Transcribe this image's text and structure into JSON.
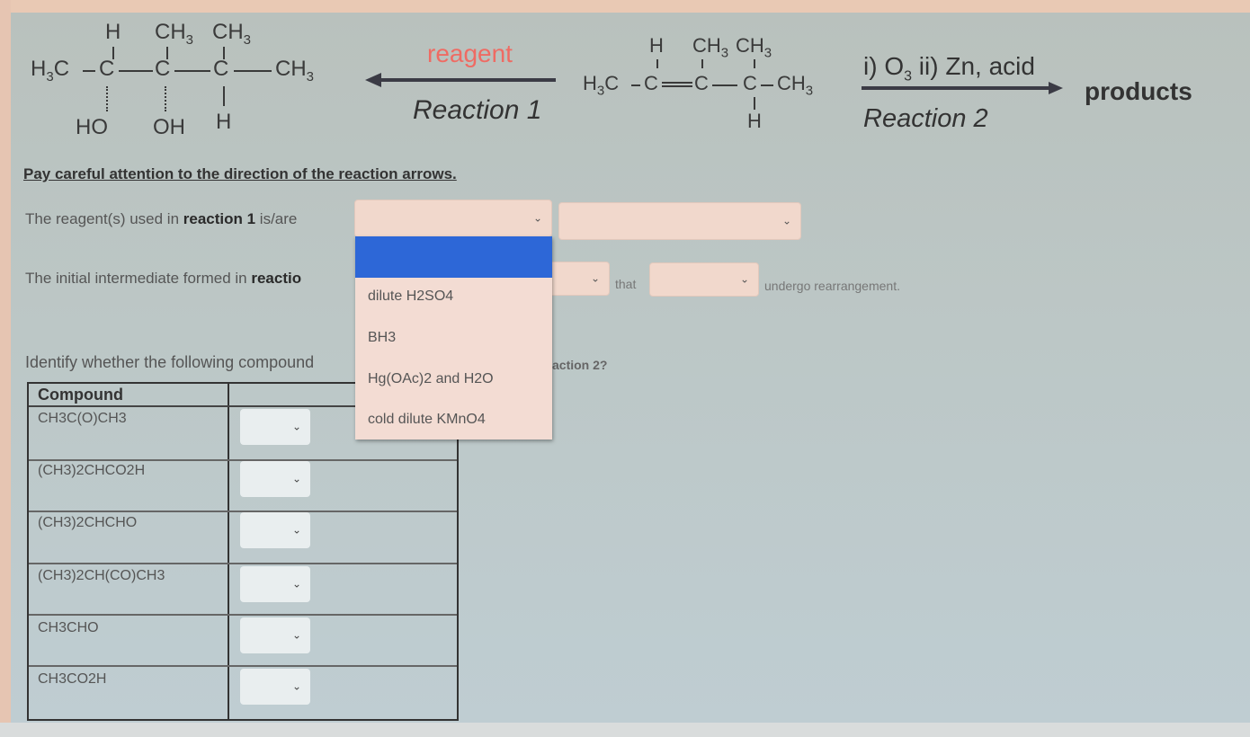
{
  "scheme": {
    "product_molecule": {
      "top_substituents": [
        "H",
        "CH3",
        "CH3"
      ],
      "main_chain": [
        "H3C",
        "C",
        "C",
        "C",
        "CH3"
      ],
      "bottom_substituents": [
        "HO",
        "OH",
        "H"
      ]
    },
    "reaction1": {
      "reagent_label": "reagent",
      "label": "Reaction 1",
      "direction": "left"
    },
    "starting_alkene": {
      "top_substituents": [
        "H",
        "CH3",
        "CH3"
      ],
      "main_chain": [
        "H3C",
        "C",
        "C",
        "C",
        "CH3"
      ],
      "bottom_substituents": [
        "H"
      ]
    },
    "reaction2": {
      "conditions": "i) O3 ii) Zn, acid",
      "label": "Reaction 2",
      "direction": "right"
    },
    "products_label": "products",
    "colors": {
      "reagent": "#ef6b63",
      "highlight": "#2d67d7"
    }
  },
  "instructions": "Pay careful attention to the direction of the reaction arrows.",
  "question1": {
    "prefix": "The reagent(s) used in ",
    "bold": "reaction 1",
    "suffix": " is/are",
    "select1_value": "",
    "select2_value": ""
  },
  "question2": {
    "prefix": "The initial intermediate formed in ",
    "bold_visible": "reactio",
    "select1_value": "",
    "connector": "that",
    "select2_value": "",
    "suffix": "undergo rearrangement."
  },
  "dropdown": {
    "open": true,
    "highlighted_option": "",
    "options": [
      "dilute H2SO4",
      "BH3",
      "Hg(OAc)2 and H2O",
      "cold dilute KMnO4"
    ]
  },
  "question3": {
    "prefix_visible": "Identify whether the following compound",
    "suffix_visible": "action 2?"
  },
  "table": {
    "headers": [
      "Compound",
      ""
    ],
    "rows": [
      {
        "compound": "CH3C(O)CH3",
        "value": ""
      },
      {
        "compound": "(CH3)2CHCO2H",
        "value": ""
      },
      {
        "compound": "(CH3)2CHCHO",
        "value": ""
      },
      {
        "compound": "(CH3)2CH(CO)CH3",
        "value": ""
      },
      {
        "compound": "CH3CHO",
        "value": ""
      },
      {
        "compound": "CH3CO2H",
        "value": ""
      }
    ]
  }
}
